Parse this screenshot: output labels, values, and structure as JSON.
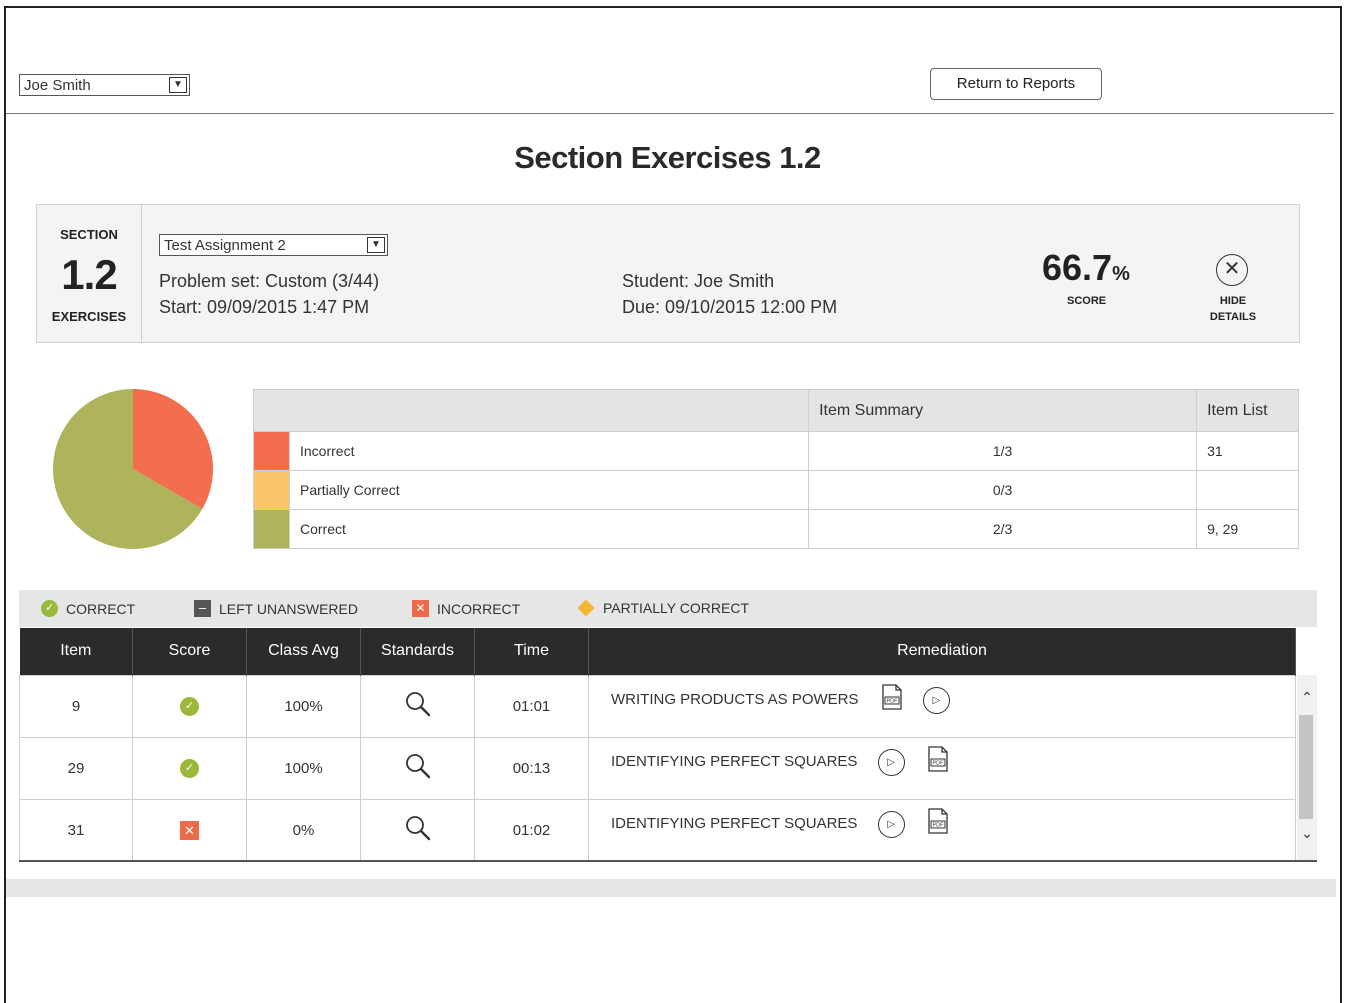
{
  "header": {
    "student_select_value": "Joe Smith",
    "return_button_label": "Return to Reports"
  },
  "page_title": "Section Exercises 1.2",
  "info": {
    "section_label": "SECTION",
    "section_number": "1.2",
    "exercises_label": "EXERCISES",
    "assignment_select_value": "Test Assignment 2",
    "problem_set": "Problem set: Custom (3/44)",
    "start": "Start: 09/09/2015 1:47 PM",
    "student": "Student: Joe Smith",
    "due": "Due: 09/10/2015 12:00 PM",
    "score_value": "66.7",
    "score_unit": "%",
    "score_label": "SCORE",
    "hide_label_line1": "HIDE",
    "hide_label_line2": "DETAILS"
  },
  "pie": {
    "incorrect_fraction": 0.3333,
    "partial_fraction": 0,
    "correct_fraction": 0.6667,
    "colors": {
      "incorrect": "#f26e4f",
      "partial": "#f9c66b",
      "correct": "#adb45c"
    }
  },
  "summary": {
    "col_summary": "Item Summary",
    "col_list": "Item List",
    "rows": [
      {
        "label": "Incorrect",
        "summary": "1/3",
        "list": "31",
        "color": "#f26e4f"
      },
      {
        "label": "Partially Correct",
        "summary": "0/3",
        "list": "",
        "color": "#f9c66b"
      },
      {
        "label": "Correct",
        "summary": "2/3",
        "list": "9, 29",
        "color": "#adb45c"
      }
    ]
  },
  "legend": {
    "correct": "CORRECT",
    "unanswered": "LEFT UNANSWERED",
    "incorrect": "INCORRECT",
    "partial": "PARTIALLY CORRECT"
  },
  "items_table": {
    "headers": {
      "item": "Item",
      "score": "Score",
      "class_avg": "Class Avg",
      "standards": "Standards",
      "time": "Time",
      "remediation": "Remediation"
    },
    "rows": [
      {
        "item": "9",
        "score": "correct",
        "class_avg": "100%",
        "time": "01:01",
        "remediation": "WRITING PRODUCTS AS POWERS",
        "icons": [
          "pdf",
          "play"
        ]
      },
      {
        "item": "29",
        "score": "correct",
        "class_avg": "100%",
        "time": "00:13",
        "remediation": "IDENTIFYING PERFECT SQUARES",
        "icons": [
          "play",
          "pdf"
        ]
      },
      {
        "item": "31",
        "score": "incorrect",
        "class_avg": "0%",
        "time": "01:02",
        "remediation": "IDENTIFYING PERFECT SQUARES",
        "icons": [
          "play",
          "pdf"
        ]
      }
    ]
  }
}
